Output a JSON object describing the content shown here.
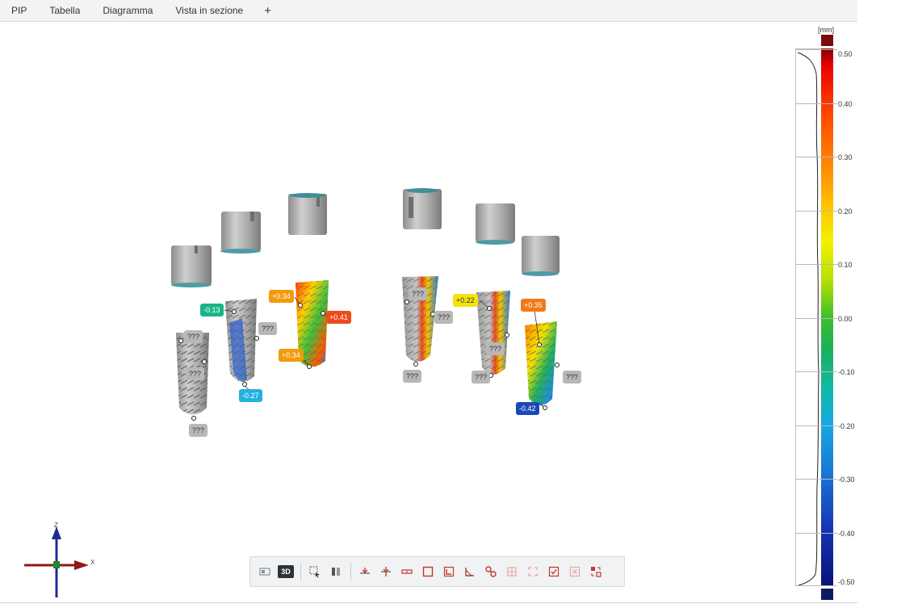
{
  "menu": {
    "items": [
      "PIP",
      "Tabella",
      "Diagramma",
      "Vista in sezione"
    ],
    "add_tab": "+"
  },
  "scale": {
    "unit": "[mm]",
    "ticks": [
      "0.50",
      "0.40",
      "0.30",
      "0.20",
      "0.10",
      "0.00",
      "-0.10",
      "-0.20",
      "-0.30",
      "-0.40",
      "-0.50"
    ]
  },
  "axes": {
    "x": "X",
    "z": "Z"
  },
  "deviation_labels": {
    "implant1": [
      "???",
      "???",
      "???"
    ],
    "implant2": [
      "-0.13",
      "???",
      "-0.27"
    ],
    "implant3": [
      "+0.34",
      "+0.41",
      "+0.34"
    ],
    "implant4": [
      "???",
      "???",
      "???"
    ],
    "implant5": [
      "+0.22",
      "???",
      "???"
    ],
    "implant6": [
      "+0.35",
      "???",
      "-0.42"
    ]
  },
  "toolbar": {
    "view_3d_label": "3D",
    "icons": [
      "2d-view-icon",
      "3d-view-icon",
      "select-icon",
      "split-view-icon",
      "align-icon",
      "pin-icon",
      "measure-icon",
      "frame-icon",
      "corner-icon",
      "angle-icon",
      "link-icon",
      "grid-icon",
      "focus-icon",
      "check-icon",
      "close-icon",
      "swap-icon"
    ]
  },
  "colors": {
    "accent_red": "#c0392b",
    "scale_top": "#7a0b0b",
    "scale_bottom": "#0c1a5e"
  }
}
